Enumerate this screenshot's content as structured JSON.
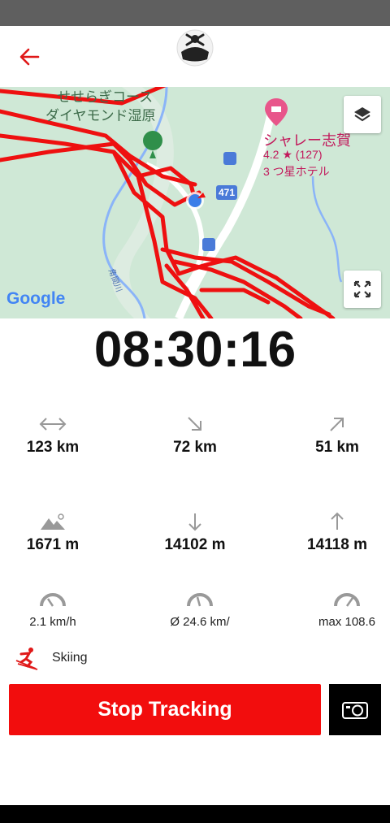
{
  "header": {
    "back_icon": "arrow-left-icon",
    "logo_icon": "skull-helmet-logo"
  },
  "map": {
    "labels": {
      "course_line1": "せせらぎコース",
      "course_line2": "ダイヤモンド湿原",
      "hotel_name": "シャレー志賀",
      "hotel_rating": "4.2 ★ (127)",
      "hotel_type": "3 つ星ホテル",
      "road_number": "471",
      "river_name": "角間川",
      "google": "Google"
    },
    "track_color": "#ee1010",
    "buttons": {
      "layers_icon": "layers-icon",
      "fullscreen_icon": "fullscreen-icon"
    }
  },
  "timer": "08:30:16",
  "stats": {
    "distance": "123 km",
    "downhill_distance": "72 km",
    "uphill_distance": "51 km",
    "altitude": "1671 m",
    "descent": "14102 m",
    "ascent": "14118 m",
    "speed": "2.1 km/h",
    "avg_speed": "Ø 24.6 km/",
    "max_speed": "max 108.6"
  },
  "activity": {
    "label": "Skiing",
    "icon": "skier-icon"
  },
  "actions": {
    "stop_label": "Stop Tracking",
    "camera_icon": "camera-icon"
  },
  "colors": {
    "accent": "#f20d0d",
    "map_bg": "#cfe8d6"
  }
}
